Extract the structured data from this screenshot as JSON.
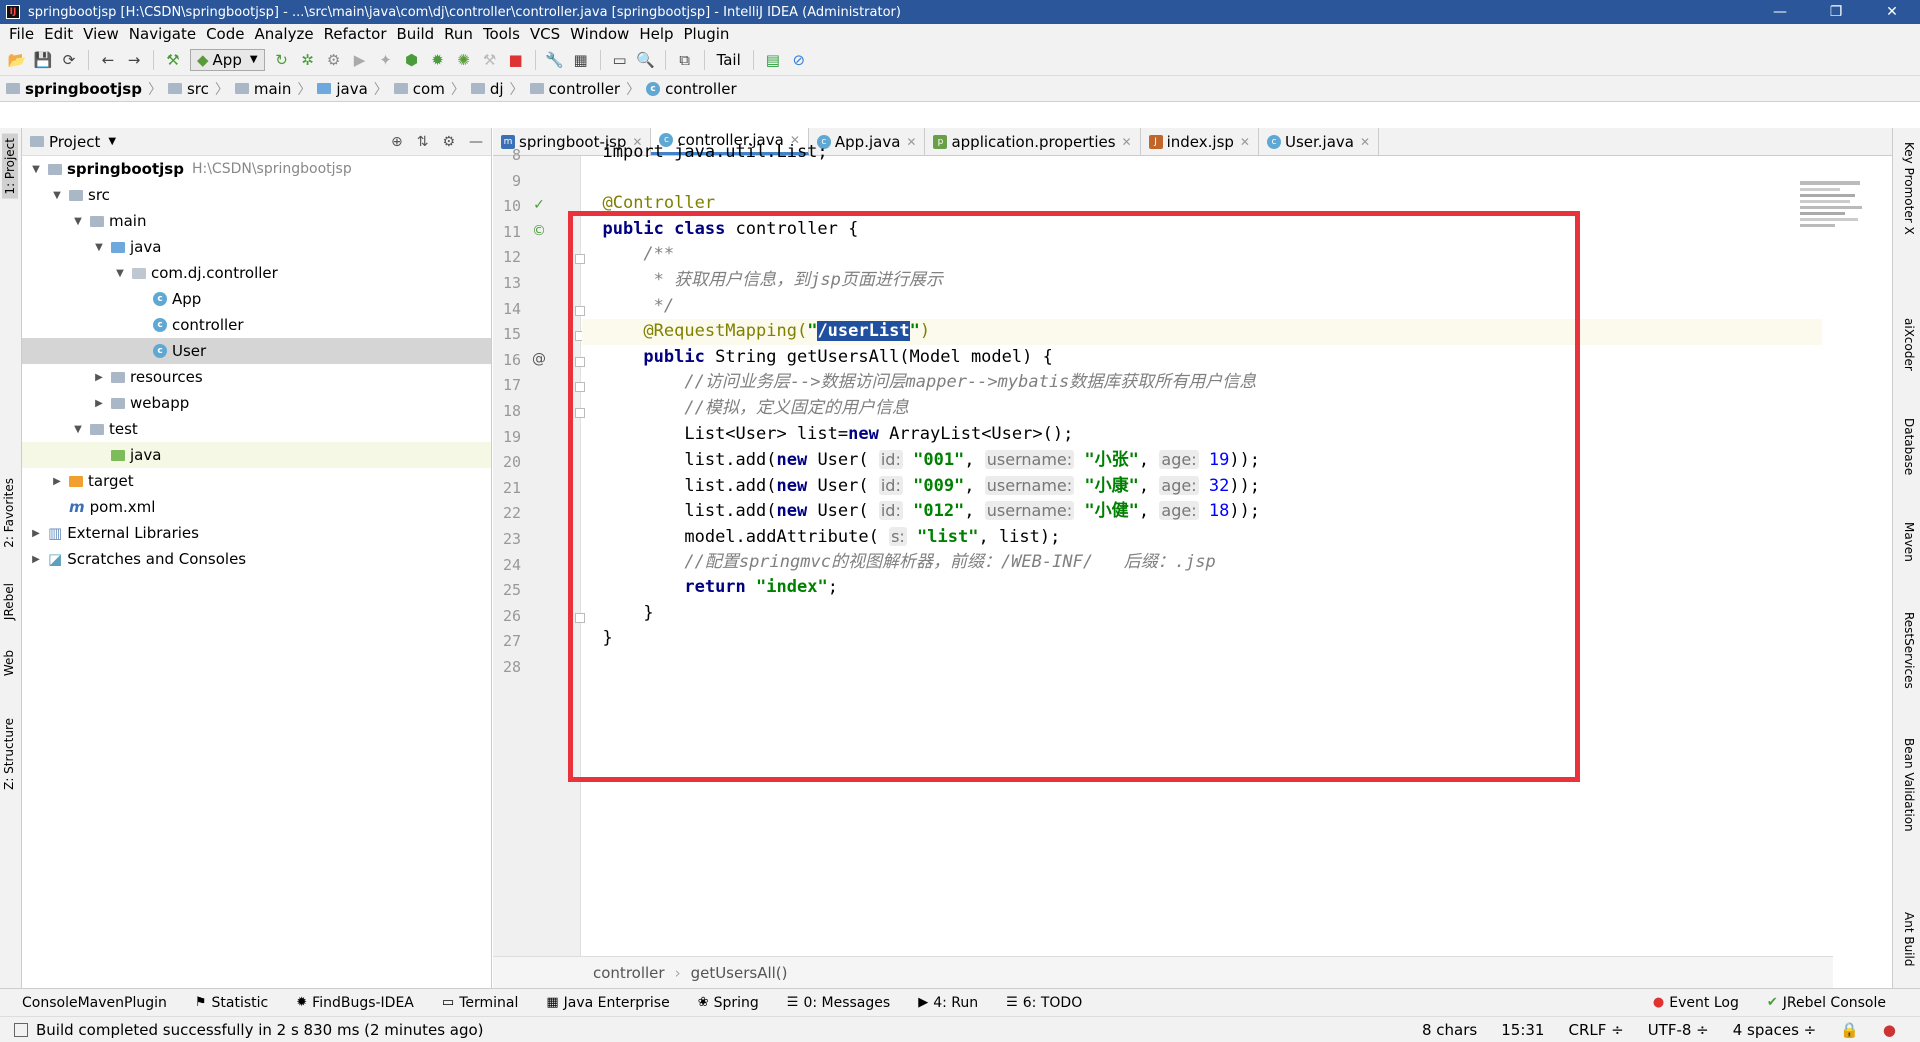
{
  "window": {
    "title": "springbootjsp [H:\\CSDN\\springbootjsp] - ...\\src\\main\\java\\com\\dj\\controller\\controller.java [springbootjsp] - IntelliJ IDEA (Administrator)",
    "minimize": "—",
    "restore": "❐",
    "close": "✕"
  },
  "menu": [
    "File",
    "Edit",
    "View",
    "Navigate",
    "Code",
    "Analyze",
    "Refactor",
    "Build",
    "Run",
    "Tools",
    "VCS",
    "Window",
    "Help",
    "Plugin"
  ],
  "toolbar": {
    "run_config": "App",
    "tail": "Tail"
  },
  "breadcrumbs": [
    "springbootjsp",
    "src",
    "main",
    "java",
    "com",
    "dj",
    "controller",
    "controller"
  ],
  "project_panel": {
    "title": "Project",
    "tree": [
      {
        "label": "springbootjsp",
        "extra": "H:\\CSDN\\springbootjsp",
        "depth": 0,
        "arrow": "open",
        "icon": "folder"
      },
      {
        "label": "src",
        "depth": 1,
        "arrow": "open",
        "icon": "folder"
      },
      {
        "label": "main",
        "depth": 2,
        "arrow": "open",
        "icon": "folder"
      },
      {
        "label": "java",
        "depth": 3,
        "arrow": "open",
        "icon": "folder-blue"
      },
      {
        "label": "com.dj.controller",
        "depth": 4,
        "arrow": "open",
        "icon": "package"
      },
      {
        "label": "App",
        "depth": 5,
        "arrow": "none",
        "icon": "class"
      },
      {
        "label": "controller",
        "depth": 5,
        "arrow": "none",
        "icon": "class"
      },
      {
        "label": "User",
        "depth": 5,
        "arrow": "none",
        "icon": "class",
        "selected": true
      },
      {
        "label": "resources",
        "depth": 3,
        "arrow": "closed",
        "icon": "folder"
      },
      {
        "label": "webapp",
        "depth": 3,
        "arrow": "closed",
        "icon": "folder"
      },
      {
        "label": "test",
        "depth": 2,
        "arrow": "open",
        "icon": "folder"
      },
      {
        "label": "java",
        "depth": 3,
        "arrow": "none",
        "icon": "folder-green",
        "hl": true
      },
      {
        "label": "target",
        "depth": 1,
        "arrow": "closed",
        "icon": "folder-orange"
      },
      {
        "label": "pom.xml",
        "depth": 1,
        "arrow": "none",
        "icon": "maven"
      },
      {
        "label": "External Libraries",
        "depth": 0,
        "arrow": "closed",
        "icon": "libs"
      },
      {
        "label": "Scratches and Consoles",
        "depth": 0,
        "arrow": "closed",
        "icon": "scratch"
      }
    ]
  },
  "left_tabs": [
    "1: Project",
    "2: Favorites",
    "JRebel",
    "Web",
    "Z: Structure"
  ],
  "right_tabs": [
    "Key Promoter X",
    "aiXcoder",
    "Database",
    "Maven",
    "RestServices",
    "Bean Validation",
    "Ant Build"
  ],
  "editor_tabs": [
    {
      "label": "springboot-jsp",
      "icon": "m",
      "active": false
    },
    {
      "label": "controller.java",
      "icon": "c",
      "active": true
    },
    {
      "label": "App.java",
      "icon": "c",
      "active": false
    },
    {
      "label": "application.properties",
      "icon": "p",
      "active": false
    },
    {
      "label": "index.jsp",
      "icon": "jsp",
      "active": false
    },
    {
      "label": "User.java",
      "icon": "c",
      "active": false
    }
  ],
  "code_lines": [
    "8",
    "9",
    "10",
    "11",
    "12",
    "13",
    "14",
    "15",
    "16",
    "17",
    "18",
    "19",
    "20",
    "21",
    "22",
    "23",
    "24",
    "25",
    "26",
    "27",
    "28"
  ],
  "code": {
    "l8": "import java.util.List;",
    "l10": "@Controller",
    "l11_kw": "public class",
    "l11_rest": " controller {",
    "l12": "/**",
    "l13": " * 获取用户信息，到jsp页面进行展示",
    "l14": " */",
    "l15_ann": "@RequestMapping(",
    "l15_q1": "\"",
    "l15_sel": "/userList",
    "l15_q2": "\"",
    "l15_end": ")",
    "l16_kw": "public",
    "l16_rest": " String getUsersAll(Model model) {",
    "l17": "//访问业务层-->数据访问层mapper-->mybatis数据库获取所有用户信息",
    "l18": "//模拟，定义固定的用户信息",
    "l19_a": "List<User> list=",
    "l19_kw": "new",
    "l19_b": " ArrayList<User>();",
    "users": [
      {
        "id": "\"001\"",
        "name": "\"小张\"",
        "age": "19"
      },
      {
        "id": "\"009\"",
        "name": "\"小康\"",
        "age": "32"
      },
      {
        "id": "\"012\"",
        "name": "\"小健\"",
        "age": "18"
      }
    ],
    "list_add": "list.add(",
    "new_kw": "new",
    "user_cls": " User( ",
    "hint_id": "id:",
    "hint_username": "username:",
    "hint_age": "age:",
    "l23_a": "model.addAttribute( ",
    "l23_hint": "s:",
    "l23_str": "\"list\"",
    "l23_b": ", list);",
    "l24": "//配置springmvc的视图解析器，前缀：/WEB-INF/   后缀：.jsp",
    "l25_kw": "return",
    "l25_str": "\"index\"",
    "l25_end": ";",
    "l26": "}",
    "l27": "}"
  },
  "editor_footer": [
    "controller",
    "getUsersAll()"
  ],
  "bottom_tools": [
    "ConsoleMavenPlugin",
    "Statistic",
    "FindBugs-IDEA",
    "Terminal",
    "Java Enterprise",
    "Spring",
    "0: Messages",
    "4: Run",
    "6: TODO"
  ],
  "bottom_right": [
    "Event Log",
    "JRebel Console"
  ],
  "status": {
    "message": "Build completed successfully in 2 s 830 ms (2 minutes ago)",
    "chars": "8 chars",
    "pos": "15:31",
    "crlf": "CRLF ÷",
    "enc": "UTF-8 ÷",
    "indent": "4 spaces ÷"
  }
}
